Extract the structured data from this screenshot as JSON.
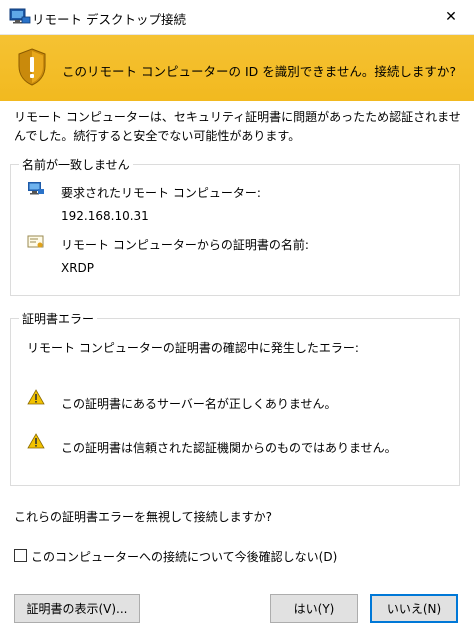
{
  "window": {
    "title": "リモート デスクトップ接続",
    "close_glyph": "✕"
  },
  "banner": {
    "message": "このリモート コンピューターの ID を識別できません。接続しますか?",
    "color": "#f4bf2b",
    "icon": "warning-shield-icon"
  },
  "intro": {
    "text": "リモート コンピューターは、セキュリティ証明書に問題があったため認証されませんでした。続行すると安全でない可能性があります。"
  },
  "name_mismatch": {
    "label": "名前が一致しません",
    "requested_label": "要求されたリモート コンピューター:",
    "requested_value": "192.168.10.31",
    "cert_name_label": "リモート コンピューターからの証明書の名前:",
    "cert_name_value": "XRDP"
  },
  "cert_errors": {
    "label": "証明書エラー",
    "heading": "リモート コンピューターの証明書の確認中に発生したエラー:",
    "errors": [
      "この証明書にあるサーバー名が正しくありません。",
      "この証明書は信頼された認証機関からのものではありません。"
    ]
  },
  "prompt": {
    "question": "これらの証明書エラーを無視して接続しますか?",
    "checkbox_label": "このコンピューターへの接続について今後確認しない(D)",
    "checkbox_checked": false
  },
  "buttons": {
    "view_cert": "証明書の表示(V)...",
    "yes": "はい(Y)",
    "no": "いいえ(N)"
  },
  "colors": {
    "accent_border": "#0078d7",
    "warning_yellow": "#f4bf2b"
  }
}
